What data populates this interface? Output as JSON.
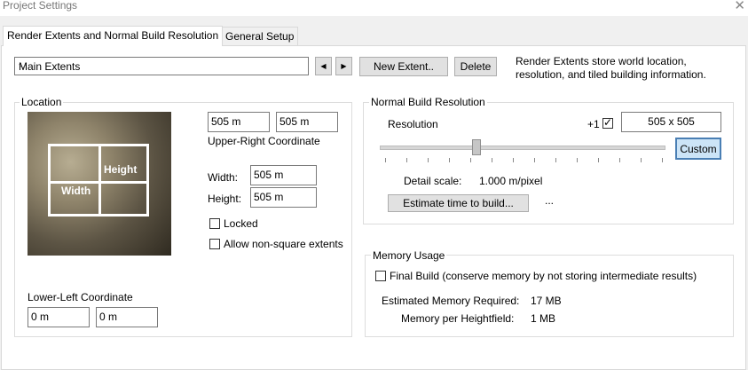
{
  "window": {
    "title": "Project Settings",
    "close_glyph": "✕"
  },
  "tabs": [
    {
      "label": "Render Extents and Normal Build Resolution"
    },
    {
      "label": "General Setup"
    }
  ],
  "extent_selector": {
    "value": "Main Extents",
    "arrow_glyph": "⌵"
  },
  "nav": {
    "prev_glyph": "◀",
    "next_glyph": "▶"
  },
  "buttons": {
    "new_extent": "New Extent..",
    "delete": "Delete",
    "custom": "Custom",
    "estimate": "Estimate time to build...",
    "ellipsis": "..."
  },
  "info_text": "Render Extents store world location, resolution, and tiled building information.",
  "location": {
    "label": "Location",
    "map_labels": {
      "height": "Height",
      "width": "Width"
    },
    "upper_right": {
      "x": "505 m",
      "y": "505 m",
      "caption": "Upper-Right Coordinate"
    },
    "width_label": "Width:",
    "width_value": "505 m",
    "height_label": "Height:",
    "height_value": "505 m",
    "locked_label": "Locked",
    "nonsquare_label": "Allow non-square extents",
    "lower_left": {
      "caption": "Lower-Left Coordinate",
      "x": "0 m",
      "y": "0 m"
    }
  },
  "resolution": {
    "label": "Normal Build Resolution",
    "resolution_label": "Resolution",
    "multiplier": "+1",
    "value": "505 x 505",
    "detail_scale_label": "Detail scale:",
    "detail_scale_value": "1.000 m/pixel",
    "slider_fraction": 0.34
  },
  "memory": {
    "label": "Memory Usage",
    "final_build_label": "Final Build (conserve memory by not storing intermediate results)",
    "estimated_label": "Estimated Memory Required:",
    "estimated_value": "17 MB",
    "per_heightfield_label": "Memory per Heightfield:",
    "per_heightfield_value": "1 MB"
  }
}
